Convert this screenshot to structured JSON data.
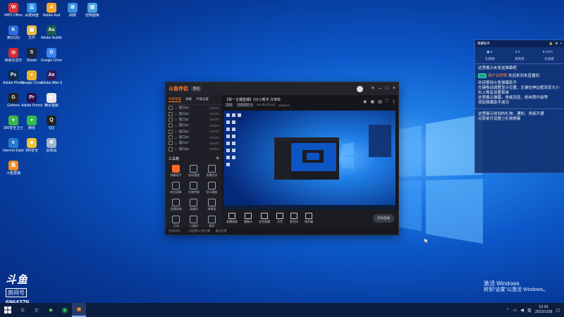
{
  "desktop": {
    "icons": [
      {
        "label": "WPS Office",
        "glyph": "W",
        "color": "#e0312f"
      },
      {
        "label": "百度网盘",
        "glyph": "云",
        "color": "#2d8cf0"
      },
      {
        "label": "Adobe Aud",
        "glyph": "A",
        "color": "#f6a623"
      },
      {
        "label": "网络",
        "glyph": "⊞",
        "color": "#3a8ee6"
      },
      {
        "label": "控制面板",
        "glyph": "▤",
        "color": "#4aa3df"
      },
      {
        "label": "腾讯QQ",
        "glyph": "K",
        "color": "#2b6de0"
      },
      {
        "label": "文件",
        "glyph": "▦",
        "color": "#e8b64a"
      },
      {
        "label": "Adobe Audition",
        "glyph": "Au",
        "color": "#1c5a4f"
      },
      {
        "label": "网易云音乐",
        "glyph": "◎",
        "color": "#d6262f"
      },
      {
        "label": "Steam",
        "glyph": "S",
        "color": "#1b2838"
      },
      {
        "label": "Google Chrome",
        "glyph": "G",
        "color": "#3a84f0"
      },
      {
        "label": "Adobe Photoshop",
        "glyph": "Ps",
        "color": "#0e2a4a"
      },
      {
        "label": "Google Chrome",
        "glyph": "●",
        "color": "#f0b22a"
      },
      {
        "label": "Adobe After Effects",
        "glyph": "Ae",
        "color": "#2b1a5a"
      },
      {
        "label": "Geforce",
        "glyph": "G",
        "color": "#222"
      },
      {
        "label": "Adobe Premiere",
        "glyph": "Pr",
        "color": "#2a0e4a"
      },
      {
        "label": "腾讯视频",
        "glyph": "▶",
        "color": "#e8e8e8"
      },
      {
        "label": "360安全卫士",
        "glyph": "●",
        "color": "#3cb64a"
      },
      {
        "label": "微信",
        "glyph": "●",
        "color": "#2dbf4b"
      },
      {
        "label": "QQ",
        "glyph": "Q",
        "color": "#222"
      },
      {
        "label": "Internet Explorer",
        "glyph": "e",
        "color": "#2a78d4"
      },
      {
        "label": "360安全",
        "glyph": "◆",
        "color": "#f2c230"
      },
      {
        "label": "回收站",
        "glyph": "♻",
        "color": "#9fb4cf"
      },
      {
        "label": "斗鱼直播",
        "glyph": "鱼",
        "color": "#f08a1c"
      }
    ]
  },
  "app": {
    "logo": "斗鱼伴侣",
    "badge": "精选",
    "left_tabs": [
      "场景管理",
      "弹幕",
      "开播设置"
    ],
    "scenes": [
      "窗口16",
      "窗口20",
      "窗口21",
      "窗口22",
      "窗口24",
      "窗口25",
      "窗口27",
      "窗口28"
    ],
    "tools_title": "工具箱",
    "tools": [
      "弹幕助手",
      "房间管理",
      "直播任务",
      "粉丝勋章",
      "礼物特效",
      "音乐播放",
      "直播录像",
      "直播间",
      "弹幕墙",
      "互动",
      "二维码",
      "更多"
    ],
    "room_title": "【单一主播直播】2分小帮手 分享秒",
    "room_meta": [
      "直播",
      "直播视频 ·6",
      "2022年1月28日",
      "6964379"
    ],
    "bottom_tools": [
      "直播录屏",
      "摄像头",
      "全民直播",
      "文字",
      "麦克风",
      "扬声器"
    ],
    "start_live": "开始直播",
    "status": [
      "在线时间：",
      "已配置0/0 的主播",
      "跳过设置"
    ]
  },
  "assistant": {
    "title": "弹幕助手",
    "stats": [
      "0",
      "0",
      "1473"
    ],
    "tabs": [
      "礼物榜",
      "贵宾席",
      "在线榜"
    ],
    "line1": "这里展示未发送弹幕呢",
    "welcome_tag": "欢迎",
    "welcome_name": "用户名称称",
    "welcome_text": "欢迎来到本直播间",
    "tips": [
      "欢迎使用斗鱼弹幕助手",
      "左键拖动调整显示位置，左键拉伸边框改变大小",
      "右上角有设置菜单",
      "这里展示弹幕，贵族消息，粉丝牌升级等",
      "添加弹幕助手成功"
    ],
    "line_bottom": "这里展示收到的礼物、通知、贵族开通",
    "line_bottom2": "点菜单可设置小礼物屏蔽"
  },
  "douyu": {
    "logo": "斗鱼",
    "badge": "房间号",
    "room": "6964379"
  },
  "activation": {
    "line1": "激活 Windows",
    "line2": "转到\"设置\"以激活 Windows。"
  },
  "taskbar": {
    "icons": [
      "search-icon",
      "edge-icon",
      "360-icon",
      "wechat-icon",
      "douyu-icon"
    ],
    "time": "12:01",
    "date": "2022/1/28",
    "lang": "英"
  }
}
